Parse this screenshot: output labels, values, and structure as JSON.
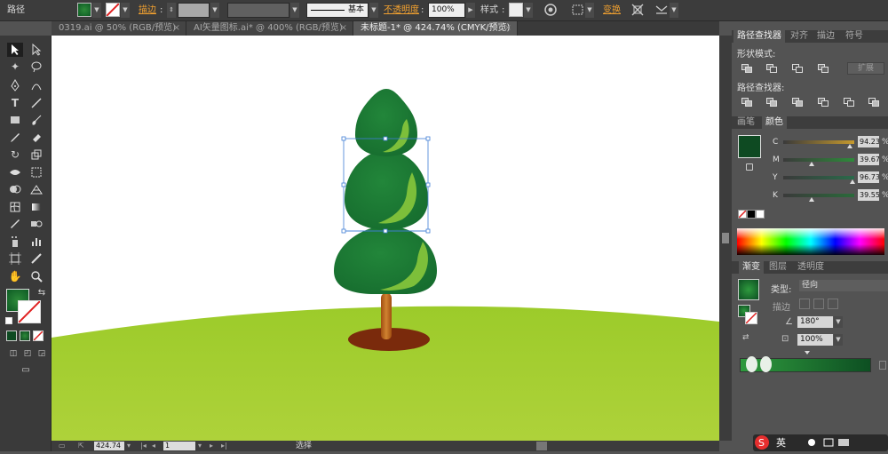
{
  "control_bar": {
    "object_type": "路径",
    "stroke_label": "描边",
    "stroke_profile": "基本",
    "opacity_label": "不透明度",
    "opacity_value": "100%",
    "style_label": "样式",
    "transform_label": "变换"
  },
  "tabs": [
    {
      "label": "0319.ai @ 50% (RGB/预览)",
      "close": "×"
    },
    {
      "label": "AI矢量图标.ai* @ 400% (RGB/预览)",
      "close": "×"
    },
    {
      "label": "未标题-1* @ 424.74% (CMYK/预览)",
      "close": "×"
    }
  ],
  "status_bar": {
    "zoom": "424.74",
    "page": "1",
    "mode": "选择"
  },
  "pathfinder": {
    "tabs": [
      "路径查找器",
      "对齐",
      "描边",
      "符号"
    ],
    "shape_modes_label": "形状模式:",
    "expand_label": "扩展",
    "pathfinders_label": "路径查找器:"
  },
  "color_panel": {
    "tabs": [
      "画笔",
      "颜色"
    ],
    "fill_color": "#0e4a22",
    "sliders": [
      {
        "key": "C",
        "value": "94.23",
        "pct": "%",
        "fraction": 0.94,
        "track": "#c69a2e"
      },
      {
        "key": "M",
        "value": "39.67",
        "pct": "%",
        "fraction": 0.4,
        "track": "#2e8a3a"
      },
      {
        "key": "Y",
        "value": "96.73",
        "pct": "%",
        "fraction": 0.97,
        "track": "#2a6a4a"
      },
      {
        "key": "K",
        "value": "39.55",
        "pct": "%",
        "fraction": 0.4,
        "track": "#2a6a3a"
      }
    ]
  },
  "gradient_panel": {
    "tabs": [
      "渐变",
      "图层",
      "透明度"
    ],
    "type_label": "类型:",
    "type_value": "径向",
    "stroke_label": "描边",
    "angle_value": "180°",
    "ratio_value": "100%",
    "colors": [
      "#2f9a3e",
      "#0d4f22"
    ]
  },
  "right_edge": {
    "position_label": "位"
  },
  "ime": {
    "lang_label": "英"
  },
  "art": {
    "ground_color": "#a6cc2d",
    "tree_dark": "#1b7a34",
    "tree_light": "#7dbf3a",
    "trunk_color": "#b9621a",
    "shadow_color": "#7a2a0c"
  }
}
